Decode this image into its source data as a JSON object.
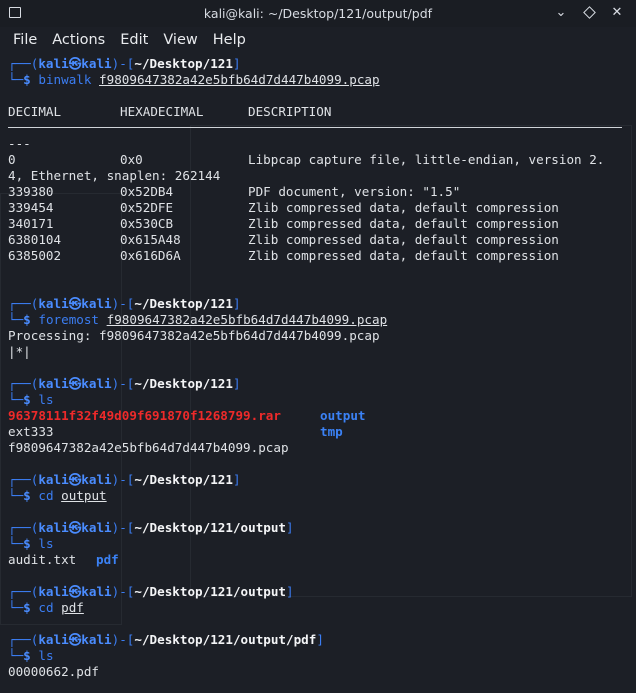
{
  "window": {
    "title": "kali@kali: ~/Desktop/121/output/pdf"
  },
  "menu": {
    "items": [
      "File",
      "Actions",
      "Edit",
      "View",
      "Help"
    ]
  },
  "prompt": {
    "user": "kali",
    "at_symbol": "㉿",
    "host": "kali",
    "dollar": "$"
  },
  "blocks": {
    "b1": {
      "path": "~/Desktop/121",
      "command": "binwalk",
      "argument": "f9809647382a42e5bfb64d7d447b4099.pcap"
    },
    "binwalk_table": {
      "headers": [
        "DECIMAL",
        "HEXADECIMAL",
        "DESCRIPTION"
      ],
      "dashes": "---",
      "rows": [
        [
          "0",
          "0x0",
          "Libpcap capture file, little-endian, version 2."
        ],
        [
          "4, Ethernet, snaplen: 262144",
          "",
          ""
        ],
        [
          "339380",
          "0x52DB4",
          "PDF document, version: \"1.5\""
        ],
        [
          "339454",
          "0x52DFE",
          "Zlib compressed data, default compression"
        ],
        [
          "340171",
          "0x530CB",
          "Zlib compressed data, default compression"
        ],
        [
          "6380104",
          "0x615A48",
          "Zlib compressed data, default compression"
        ],
        [
          "6385002",
          "0x616D6A",
          "Zlib compressed data, default compression"
        ]
      ]
    },
    "b2": {
      "path": "~/Desktop/121",
      "command": "foremost",
      "argument": "f9809647382a42e5bfb64d7d447b4099.pcap",
      "output1": "Processing: f9809647382a42e5bfb64d7d447b4099.pcap",
      "output2": "|*|"
    },
    "b3": {
      "path": "~/Desktop/121",
      "command": "ls",
      "listing": {
        "rar_file": "96378111f32f49d09f691870f1268799.rar",
        "dir_output": "output",
        "file_ext": "ext333",
        "dir_tmp": "tmp",
        "pcap_file": "f9809647382a42e5bfb64d7d447b4099.pcap"
      }
    },
    "b4": {
      "path": "~/Desktop/121",
      "command": "cd",
      "argument": "output"
    },
    "b5": {
      "path": "~/Desktop/121/output",
      "command": "ls",
      "listing": {
        "file": "audit.txt",
        "dir": "pdf"
      }
    },
    "b6": {
      "path": "~/Desktop/121/output",
      "command": "cd",
      "argument": "pdf"
    },
    "b7": {
      "path": "~/Desktop/121/output/pdf",
      "command": "ls",
      "listing": {
        "file": "00000662.pdf"
      }
    }
  },
  "colors": {
    "background": "#1c1f26",
    "prompt_blue": "#3b7df2",
    "directory_blue": "#3b82f6",
    "archive_red": "#ee2a2a",
    "text": "#dfe2e6"
  }
}
